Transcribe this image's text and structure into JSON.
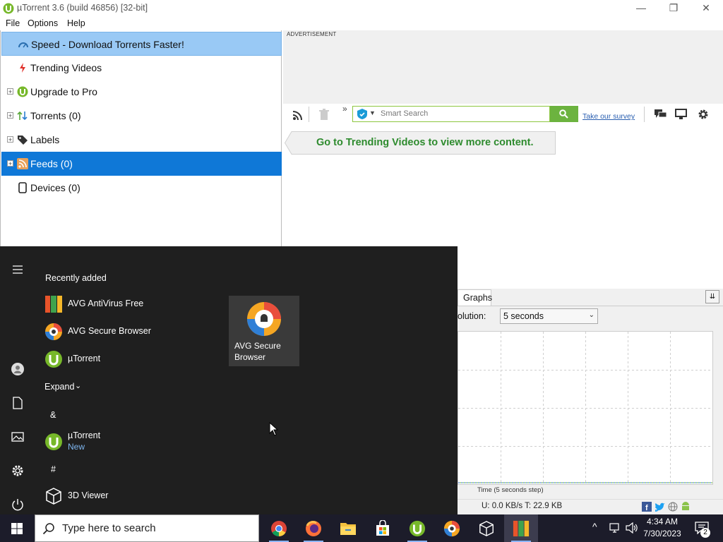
{
  "window": {
    "title": "µTorrent 3.6  (build 46856) [32-bit]",
    "controls": {
      "minimize": "—",
      "maximize": "❐",
      "close": "✕"
    }
  },
  "menu": {
    "items": [
      "File",
      "Options",
      "Help"
    ]
  },
  "sidebar": {
    "items": [
      {
        "label": "Speed - Download Torrents Faster!",
        "icon": "speed-gauge-icon"
      },
      {
        "label": "Trending Videos",
        "icon": "lightning-icon"
      },
      {
        "label": "Upgrade to Pro",
        "icon": "utorrent-logo-icon",
        "expander": "+"
      },
      {
        "label": "Torrents (0)",
        "icon": "torrents-arrows-icon",
        "expander": "+"
      },
      {
        "label": "Labels",
        "icon": "label-tag-icon",
        "expander": "+"
      },
      {
        "label": "Feeds (0)",
        "icon": "rss-feed-icon",
        "expander": "+"
      },
      {
        "label": "Devices (0)",
        "icon": "device-icon"
      }
    ]
  },
  "ad": {
    "label": "ADVERTISEMENT"
  },
  "toolbar": {
    "search_placeholder": "Smart Search",
    "survey_link": "Take our survey",
    "overflow": "»"
  },
  "trending_banner": {
    "text": "Go to Trending Videos to view more content."
  },
  "graph_pane": {
    "tab_label": "Graphs",
    "collapse_glyph": "⇊",
    "resolution_label": "olution:",
    "resolution_value": "5 seconds",
    "x_label": "Time (5 seconds step)",
    "status": "U: 0.0 KB/s T: 22.9 KB"
  },
  "chart_data": {
    "type": "line",
    "xlabel": "Time (5 seconds step)",
    "ylabel": "",
    "x": [
      0,
      1,
      2,
      3,
      4,
      5,
      6,
      7,
      8,
      9,
      10,
      11,
      12,
      13,
      14,
      15,
      16,
      17,
      18,
      19,
      20,
      21,
      22,
      23,
      24,
      25,
      26,
      27,
      28,
      29,
      30,
      31,
      32,
      33,
      34,
      35,
      36,
      37,
      38,
      39,
      40
    ],
    "series": [
      {
        "values": [
          0,
          0,
          0,
          0,
          0,
          0,
          0,
          0,
          0,
          0,
          0,
          0,
          0,
          0,
          0,
          0,
          0,
          0,
          0,
          0,
          0,
          0,
          0,
          0,
          0,
          0,
          0,
          0,
          0,
          0,
          0,
          0,
          0,
          0,
          0,
          0,
          0,
          0,
          0,
          0,
          0
        ],
        "color": "#6cbf3a"
      },
      {
        "values": [
          0,
          0,
          0,
          0,
          0,
          0,
          0,
          0,
          0,
          0,
          0,
          0,
          0,
          0,
          0,
          0,
          0,
          0,
          0,
          0,
          0,
          0,
          0,
          0,
          0,
          0,
          0,
          0,
          0,
          0,
          0,
          0,
          0,
          0,
          0,
          0,
          0,
          0,
          0,
          0,
          0
        ],
        "color": "#3a6fd8"
      }
    ]
  },
  "start_menu": {
    "recently_added_heading": "Recently added",
    "recent_apps": [
      {
        "name": "AVG AntiVirus Free",
        "icon": "avg-antivirus-icon"
      },
      {
        "name": "AVG Secure Browser",
        "icon": "avg-browser-icon"
      },
      {
        "name": "µTorrent",
        "icon": "utorrent-icon"
      }
    ],
    "expand_label": "Expand",
    "section_amp": "&",
    "amp_app": {
      "name": "µTorrent",
      "badge": "New"
    },
    "section_hash": "#",
    "hash_app": {
      "name": "3D Viewer"
    },
    "tile": {
      "label_line1": "AVG Secure",
      "label_line2": "Browser"
    }
  },
  "taskbar": {
    "search_placeholder": "Type here to search",
    "apps": [
      "chrome-icon",
      "firefox-icon",
      "file-explorer-icon",
      "store-icon",
      "utorrent-icon",
      "avg-browser-icon",
      "3d-viewer-icon",
      "avg-antivirus-icon"
    ],
    "time": "4:34 AM",
    "date": "7/30/2023",
    "notification_count": "2"
  }
}
